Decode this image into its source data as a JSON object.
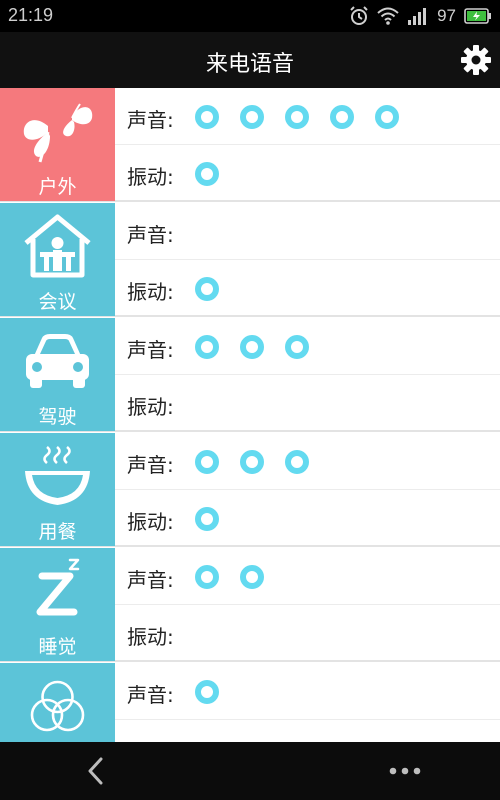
{
  "status": {
    "time": "21:19",
    "battery": "97"
  },
  "header": {
    "title": "来电语音"
  },
  "labels": {
    "sound": "声音:",
    "vibrate": "振动:"
  },
  "colors": {
    "outdoor_tile": "#f5797d",
    "tile": "#5cc4d8",
    "dot": "#63daf0"
  },
  "profiles": [
    {
      "name": "户外",
      "icon": "butterfly-icon",
      "sound_level": 5,
      "vibrate_level": 1
    },
    {
      "name": "会议",
      "icon": "meeting-room-icon",
      "sound_level": 0,
      "vibrate_level": 1
    },
    {
      "name": "驾驶",
      "icon": "car-icon",
      "sound_level": 3,
      "vibrate_level": 0
    },
    {
      "name": "用餐",
      "icon": "steaming-bowl-icon",
      "sound_level": 3,
      "vibrate_level": 1
    },
    {
      "name": "睡觉",
      "icon": "sleep-z-icon",
      "sound_level": 2,
      "vibrate_level": 0
    },
    {
      "name": "",
      "icon": "circles-icon",
      "sound_level": 1,
      "vibrate_level": 0
    }
  ],
  "nav": {
    "back_icon": "back-arrow-icon",
    "more_icon": "more-dots-icon"
  }
}
